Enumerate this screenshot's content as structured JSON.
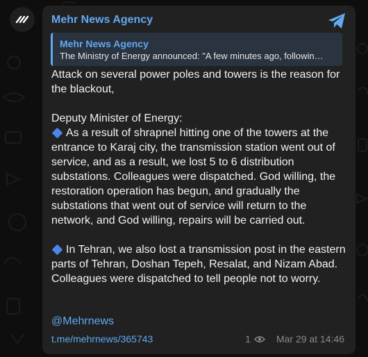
{
  "channel": {
    "sender_name": "Mehr News Agency"
  },
  "reply": {
    "name": "Mehr News Agency",
    "text": "The Ministry of Energy announced: \"A few minutes ago, followin…"
  },
  "message": {
    "headline": "Attack on several power poles and towers is the reason for the blackout,",
    "subhead": "Deputy Minister of Energy:",
    "point1": "As a result of shrapnel hitting one of the towers at the entrance to Karaj city, the transmission station went out of service, and as a result, we lost 5 to 6 distribution substations. Colleagues were dispatched. God willing, the restoration operation has begun, and gradually the substations that went out of service will return to the network, and God willing, repairs will be carried out.",
    "point2": "In Tehran, we also lost a transmission post in the eastern parts of Tehran, Doshan Tepeh, Resalat, and Nizam Abad. Colleagues were dispatched to tell people not to worry.",
    "handle": "@Mehrnews",
    "link": "t.me/mehrnews/365743"
  },
  "meta": {
    "views": "1",
    "timestamp": "Mar 29 at 14:46"
  },
  "icons": {
    "avatar": "mehr-logo-icon",
    "share": "telegram-share-icon",
    "views": "eye-icon",
    "bullet": "blue-diamond-icon"
  },
  "colors": {
    "background": "#0e0e0e",
    "bubble": "#212121",
    "accent": "#62a9f1",
    "text": "#f2f2f2",
    "muted": "#8a8a8a"
  }
}
